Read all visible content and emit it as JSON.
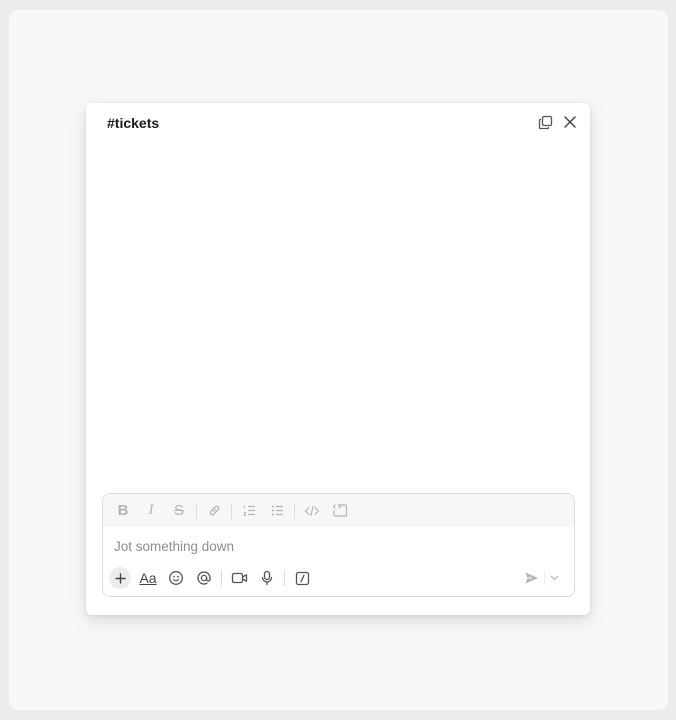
{
  "window": {
    "title": "#tickets"
  },
  "composer": {
    "placeholder": "Jot something down",
    "aa_label": "Aa"
  },
  "icons": {
    "popout": "popout-icon",
    "close": "close-icon",
    "bold": "bold-icon",
    "italic": "italic-icon",
    "strike": "strikethrough-icon",
    "link": "link-icon",
    "ordered_list": "ordered-list-icon",
    "bullet_list": "bullet-list-icon",
    "code": "code-icon",
    "code_block": "code-block-icon",
    "plus": "plus-icon",
    "emoji": "emoji-icon",
    "mention": "mention-icon",
    "video": "video-icon",
    "mic": "microphone-icon",
    "slash": "slash-command-icon",
    "send": "send-icon",
    "chevron": "chevron-down-icon"
  },
  "colors": {
    "background": "#ececec",
    "panel": "#ffffff",
    "muted_icon": "#b5b5b5",
    "active_icon": "#616061"
  }
}
